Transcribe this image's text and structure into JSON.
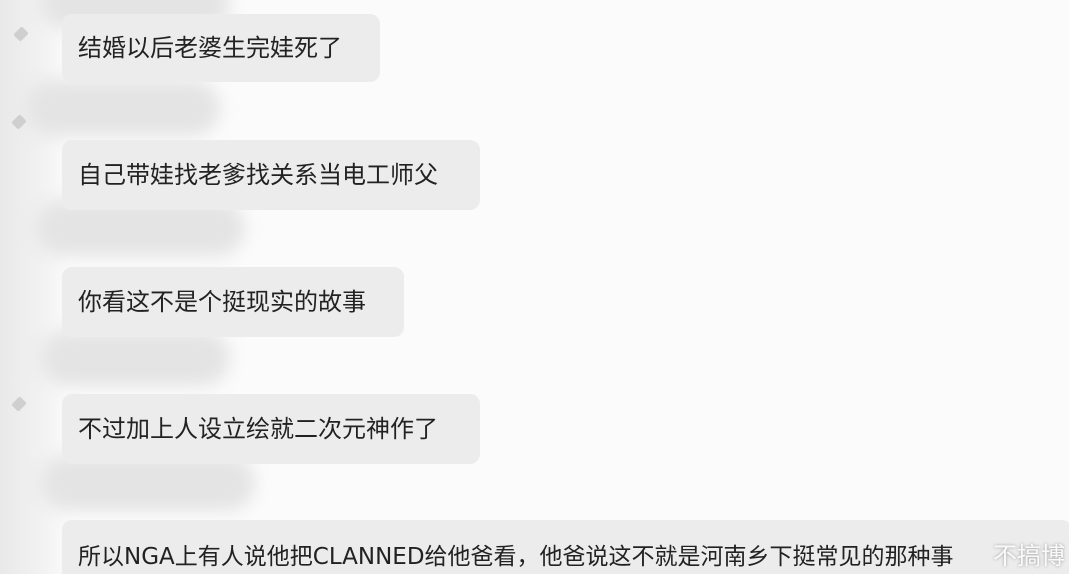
{
  "messages": [
    {
      "text": "结婚以后老婆生完娃死了"
    },
    {
      "text": "自己带娃找老爹找关系当电工师父"
    },
    {
      "text": "你看这不是个挺现实的故事"
    },
    {
      "text": "不过加上人设立绘就二次元神作了"
    },
    {
      "text": "所以NGA上有人说他把CLANNED给他爸看，他爸说这不就是河南乡下挺常见的那种事"
    }
  ],
  "watermark": "不搞博",
  "colors": {
    "bubble": "#ececec",
    "text": "#222222",
    "background": "#fbfbfb"
  }
}
